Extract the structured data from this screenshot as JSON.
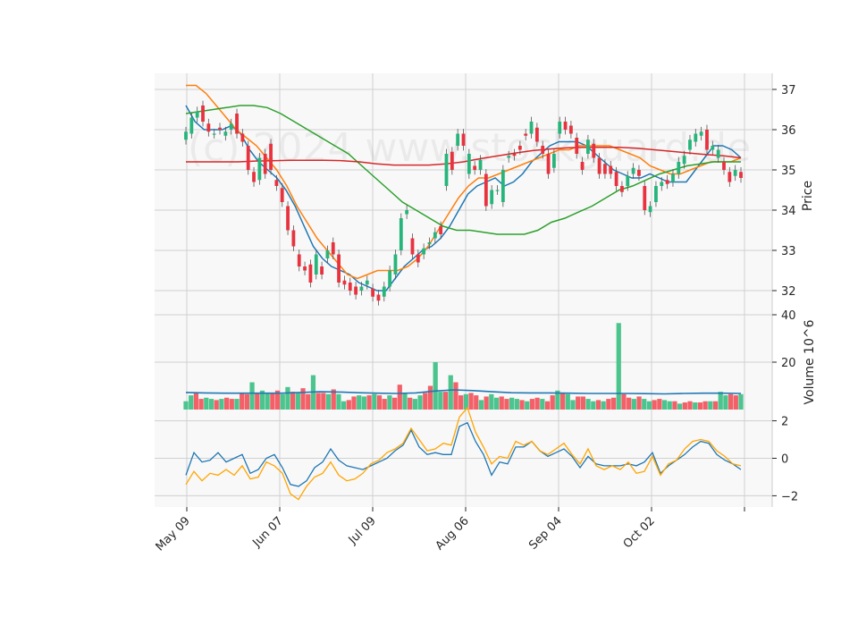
{
  "chart_data": {
    "type": "candlestick",
    "watermark": "(c) 2024 www.stockguard.de",
    "x_tick_labels": [
      "May 09",
      "Jun 07",
      "Jul 09",
      "Aug 06",
      "Sep 04",
      "Oct 02"
    ],
    "price_panel": {
      "ylabel": "Price",
      "ylim": [
        31.4,
        37.4
      ],
      "ticks": [
        32,
        33,
        34,
        35,
        36,
        37
      ],
      "moving_averages": [
        {
          "color": "#1f77b4",
          "values": [
            36.6,
            36.2,
            36.0,
            36.0,
            36.0,
            36.1,
            35.9,
            35.5,
            35.2,
            35.0,
            34.8,
            34.5,
            34.1,
            33.6,
            33.1,
            32.8,
            32.6,
            32.5,
            32.4,
            32.2,
            32.1,
            32.0,
            32.0,
            32.3,
            32.6,
            32.8,
            33.0,
            33.1,
            33.3,
            33.6,
            34.0,
            34.4,
            34.6,
            34.7,
            34.8,
            34.6,
            34.7,
            34.9,
            35.2,
            35.4,
            35.6,
            35.7,
            35.7,
            35.7,
            35.6,
            35.4,
            35.2,
            35.0,
            34.9,
            34.8,
            34.8,
            34.9,
            34.8,
            34.7,
            34.7,
            34.7,
            35.0,
            35.3,
            35.6,
            35.6,
            35.5,
            35.3
          ]
        },
        {
          "color": "#ff7f0e",
          "values": [
            37.1,
            37.1,
            36.9,
            36.6,
            36.3,
            36.0,
            35.8,
            35.6,
            35.3,
            35.0,
            34.6,
            34.1,
            33.7,
            33.3,
            33.0,
            32.7,
            32.4,
            32.3,
            32.4,
            32.5,
            32.5,
            32.5,
            32.6,
            32.8,
            33.1,
            33.5,
            33.9,
            34.3,
            34.6,
            34.8,
            34.8,
            34.9,
            35.0,
            35.1,
            35.2,
            35.3,
            35.4,
            35.5,
            35.5,
            35.6,
            35.6,
            35.6,
            35.6,
            35.5,
            35.4,
            35.3,
            35.1,
            35.0,
            34.9,
            34.9,
            35.0,
            35.1,
            35.2,
            35.2,
            35.2,
            35.3
          ]
        },
        {
          "color": "#2ca02c",
          "values": [
            36.4,
            36.45,
            36.5,
            36.55,
            36.6,
            36.6,
            36.55,
            36.4,
            36.2,
            36.0,
            35.8,
            35.6,
            35.4,
            35.1,
            34.8,
            34.5,
            34.2,
            34.0,
            33.8,
            33.6,
            33.5,
            33.5,
            33.45,
            33.4,
            33.4,
            33.4,
            33.5,
            33.7,
            33.8,
            33.95,
            34.1,
            34.3,
            34.5,
            34.6,
            34.75,
            34.9,
            35.0,
            35.1,
            35.15,
            35.2,
            35.2,
            35.2
          ]
        },
        {
          "color": "#d62728",
          "values": [
            35.2,
            35.2,
            35.2,
            35.2,
            35.22,
            35.23,
            35.24,
            35.24,
            35.24,
            35.23,
            35.2,
            35.15,
            35.12,
            35.12,
            35.12,
            35.15,
            35.2,
            35.28,
            35.35,
            35.42,
            35.48,
            35.52,
            35.55,
            35.56,
            35.56,
            35.56,
            35.54,
            35.5,
            35.46,
            35.42,
            35.38,
            35.35,
            35.3
          ]
        }
      ],
      "candles": [
        [
          35.75,
          35.95
        ],
        [
          35.9,
          36.3
        ],
        [
          36.3,
          36.45
        ],
        [
          36.6,
          36.2
        ],
        [
          36.15,
          35.95
        ],
        [
          35.9,
          35.9
        ],
        [
          36.05,
          36.0
        ],
        [
          35.85,
          35.95
        ],
        [
          36.0,
          36.15
        ],
        [
          36.4,
          35.9
        ],
        [
          35.9,
          35.7
        ],
        [
          35.6,
          35.0
        ],
        [
          34.95,
          34.7
        ],
        [
          34.75,
          35.3
        ],
        [
          35.4,
          34.9
        ],
        [
          35.65,
          35.0
        ],
        [
          34.75,
          34.6
        ],
        [
          34.55,
          34.2
        ],
        [
          34.1,
          33.5
        ],
        [
          33.5,
          33.1
        ],
        [
          32.9,
          32.6
        ],
        [
          32.6,
          32.5
        ],
        [
          32.65,
          32.2
        ],
        [
          32.4,
          32.9
        ],
        [
          32.6,
          32.4
        ],
        [
          32.8,
          33.0
        ],
        [
          33.2,
          32.9
        ],
        [
          32.9,
          32.2
        ],
        [
          32.25,
          32.15
        ],
        [
          32.2,
          32.0
        ],
        [
          32.1,
          31.9
        ],
        [
          32.0,
          32.1
        ],
        [
          32.15,
          32.25
        ],
        [
          32.05,
          31.85
        ],
        [
          31.9,
          31.75
        ],
        [
          31.85,
          32.1
        ],
        [
          32.1,
          32.5
        ],
        [
          32.4,
          32.9
        ],
        [
          33.0,
          33.8
        ],
        [
          33.9,
          34.0
        ],
        [
          33.3,
          32.9
        ],
        [
          32.9,
          32.7
        ],
        [
          32.9,
          33.05
        ],
        [
          33.15,
          33.2
        ],
        [
          33.3,
          33.45
        ],
        [
          33.6,
          33.4
        ],
        [
          34.6,
          35.4
        ],
        [
          35.45,
          35.0
        ],
        [
          35.6,
          35.9
        ],
        [
          35.9,
          35.6
        ],
        [
          34.9,
          35.4
        ],
        [
          35.1,
          35.0
        ],
        [
          35.0,
          35.25
        ],
        [
          34.9,
          34.1
        ],
        [
          34.15,
          34.5
        ],
        [
          34.5,
          34.5
        ],
        [
          34.2,
          35.0
        ],
        [
          35.3,
          35.35
        ],
        [
          35.4,
          35.35
        ],
        [
          35.6,
          35.5
        ],
        [
          35.9,
          35.85
        ],
        [
          35.9,
          36.2
        ],
        [
          36.05,
          35.7
        ],
        [
          35.6,
          35.4
        ],
        [
          35.4,
          34.9
        ],
        [
          35.05,
          35.4
        ],
        [
          35.9,
          36.2
        ],
        [
          36.2,
          36.0
        ],
        [
          36.1,
          35.9
        ],
        [
          35.8,
          35.4
        ],
        [
          35.2,
          35.0
        ],
        [
          35.4,
          35.75
        ],
        [
          35.65,
          35.3
        ],
        [
          35.3,
          34.9
        ],
        [
          35.15,
          34.9
        ],
        [
          35.1,
          34.9
        ],
        [
          34.95,
          34.6
        ],
        [
          34.6,
          34.45
        ],
        [
          34.6,
          34.85
        ],
        [
          34.9,
          35.05
        ],
        [
          35.0,
          34.85
        ],
        [
          34.6,
          34.0
        ],
        [
          33.95,
          34.1
        ],
        [
          34.2,
          34.6
        ],
        [
          34.6,
          34.7
        ],
        [
          34.75,
          34.65
        ],
        [
          34.7,
          34.9
        ],
        [
          34.9,
          35.2
        ],
        [
          35.15,
          35.35
        ],
        [
          35.5,
          35.75
        ],
        [
          35.7,
          35.9
        ],
        [
          35.85,
          35.95
        ],
        [
          36.0,
          35.5
        ],
        [
          35.5,
          35.6
        ],
        [
          35.3,
          35.5
        ],
        [
          35.2,
          35.0
        ],
        [
          34.95,
          34.7
        ],
        [
          34.85,
          35.0
        ],
        [
          34.95,
          34.8
        ]
      ]
    },
    "volume_panel": {
      "ylabel": "Volume  10^6",
      "ylim": [
        0,
        40
      ],
      "ticks": [
        20,
        40
      ],
      "average_line": {
        "color": "#1f77b4",
        "values": [
          7.2,
          7.0,
          6.9,
          6.9,
          6.9,
          6.9,
          7.2,
          7.5,
          7.4,
          7.1,
          6.9,
          6.8,
          7.0,
          7.8,
          8.3,
          8.0,
          7.5,
          7.1,
          7.0,
          7.0,
          6.9,
          6.8,
          6.8,
          6.8,
          6.7,
          6.6,
          6.8,
          6.9,
          6.9,
          6.8
        ]
      },
      "values": [
        3.5,
        6,
        7,
        4.5,
        5,
        4.5,
        4,
        4.5,
        5,
        4.5,
        4.5,
        7,
        6.5,
        11.5,
        7,
        8,
        7,
        7,
        8,
        6.5,
        9.5,
        7.5,
        7,
        9,
        6.5,
        14.5,
        7,
        7,
        6.5,
        8.5,
        6.5,
        3.5,
        4,
        5.5,
        6,
        5.5,
        6,
        6.5,
        6,
        4.5,
        6,
        5,
        10.5,
        7,
        5,
        4.5,
        6,
        7,
        10,
        20,
        7.5,
        7.5,
        14.5,
        11.5,
        6,
        6.5,
        7,
        6,
        4,
        5.5,
        6.5,
        5,
        5.5,
        4.5,
        5,
        4.5,
        4,
        3.5,
        4.5,
        5,
        4.5,
        3.5,
        6,
        8,
        7,
        6.5,
        4,
        5.5,
        5.5,
        4.5,
        3.5,
        4,
        3.5,
        4.5,
        5,
        36.5,
        6.5,
        5,
        4.5,
        5.5,
        4.5,
        3.5,
        4,
        4.5,
        4,
        3.5,
        3.5,
        2.5,
        3,
        3.5,
        3,
        3,
        3.5,
        3.5,
        3.5,
        7.5,
        6,
        6.5,
        6,
        6.5
      ]
    },
    "oscillator_panel": {
      "ylim": [
        -2.6,
        2.6
      ],
      "ticks": [
        -2,
        0,
        2
      ],
      "series": [
        {
          "color": "#1f77b4",
          "values": [
            -0.9,
            0.3,
            -0.2,
            -0.1,
            0.3,
            -0.2,
            0.0,
            0.2,
            -0.8,
            -0.6,
            0.0,
            0.2,
            -0.5,
            -1.4,
            -1.5,
            -1.2,
            -0.5,
            -0.2,
            0.5,
            -0.1,
            -0.4,
            -0.5,
            -0.6,
            -0.4,
            -0.2,
            0.0,
            0.4,
            0.7,
            1.5,
            0.6,
            0.2,
            0.3,
            0.2,
            0.2,
            1.7,
            1.9,
            0.9,
            0.2,
            -0.9,
            -0.2,
            -0.3,
            0.6,
            0.6,
            0.9,
            0.4,
            0.1,
            0.3,
            0.5,
            0.1,
            -0.5,
            0.1,
            -0.3,
            -0.4,
            -0.4,
            -0.4,
            -0.3,
            -0.4,
            -0.2,
            0.3,
            -0.8,
            -0.4,
            -0.1,
            0.2,
            0.6,
            0.9,
            0.8,
            0.2,
            -0.1,
            -0.3,
            -0.6
          ]
        },
        {
          "color": "#ffa500",
          "values": [
            -1.4,
            -0.7,
            -1.2,
            -0.8,
            -0.9,
            -0.6,
            -0.9,
            -0.4,
            -1.1,
            -1.0,
            -0.2,
            -0.4,
            -0.8,
            -1.9,
            -2.2,
            -1.5,
            -1.0,
            -0.8,
            -0.2,
            -0.9,
            -1.2,
            -1.1,
            -0.8,
            -0.3,
            -0.1,
            0.3,
            0.5,
            0.8,
            1.6,
            1.0,
            0.4,
            0.5,
            0.8,
            0.7,
            2.2,
            2.7,
            1.4,
            0.6,
            -0.3,
            0.1,
            0.0,
            0.9,
            0.7,
            0.9,
            0.4,
            0.2,
            0.5,
            0.8,
            0.2,
            -0.3,
            0.5,
            -0.4,
            -0.6,
            -0.4,
            -0.6,
            -0.2,
            -0.8,
            -0.7,
            0.1,
            -0.9,
            -0.3,
            -0.1,
            0.5,
            0.9,
            1.0,
            0.9,
            0.4,
            0.1,
            -0.3,
            -0.4
          ]
        }
      ]
    }
  }
}
